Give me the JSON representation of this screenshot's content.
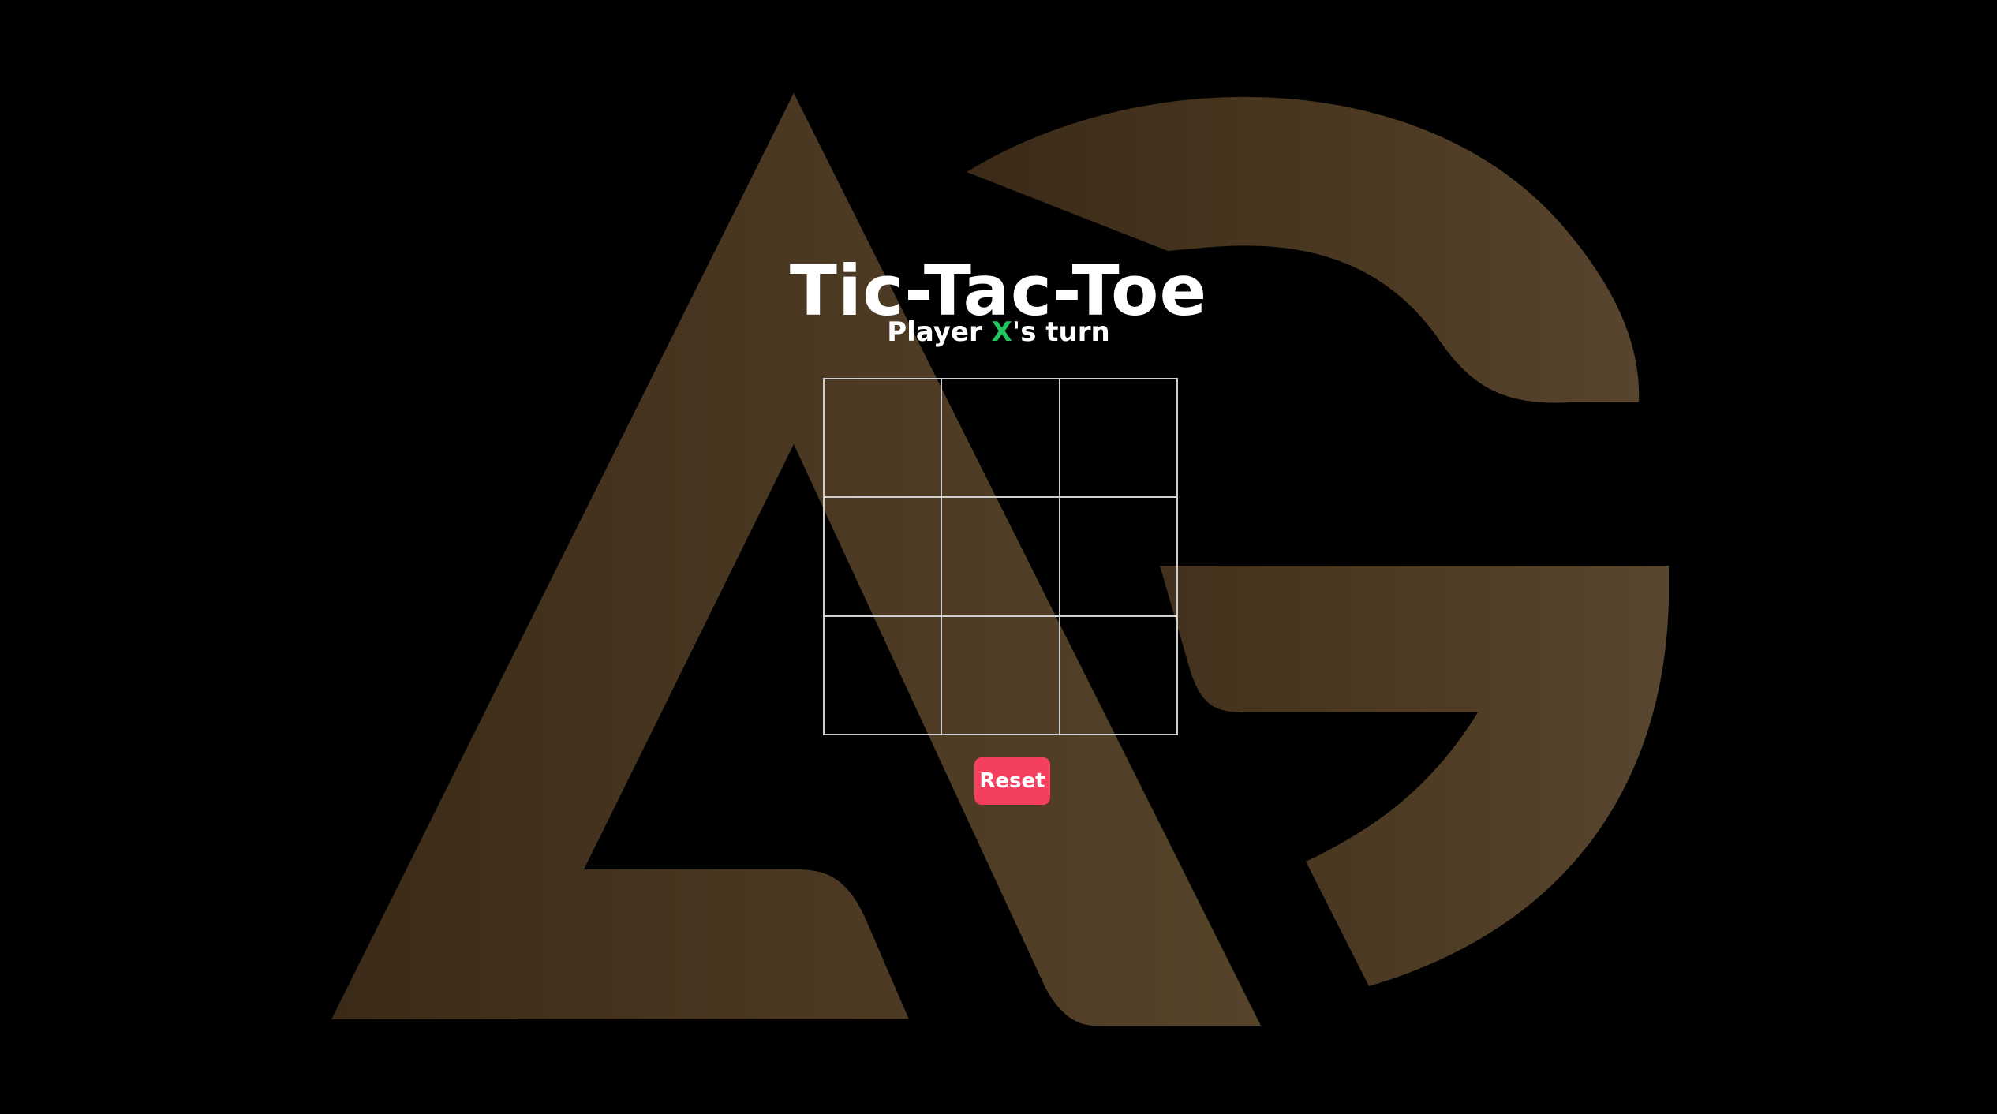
{
  "game": {
    "title": "Tic-Tac-Toe",
    "status_prefix": "Player ",
    "current_player": "X",
    "status_suffix": "'s turn",
    "board": [
      "",
      "",
      "",
      "",
      "",
      "",
      "",
      "",
      ""
    ],
    "reset_label": "Reset"
  },
  "colors": {
    "background": "#000000",
    "logo": "#4a3822",
    "text": "#ffffff",
    "player_x": "#22c55e",
    "reset_button": "#f43f5e",
    "grid_lines": "#cfcfcf"
  },
  "icons": {
    "background_logo": "ag-monogram-logo"
  }
}
